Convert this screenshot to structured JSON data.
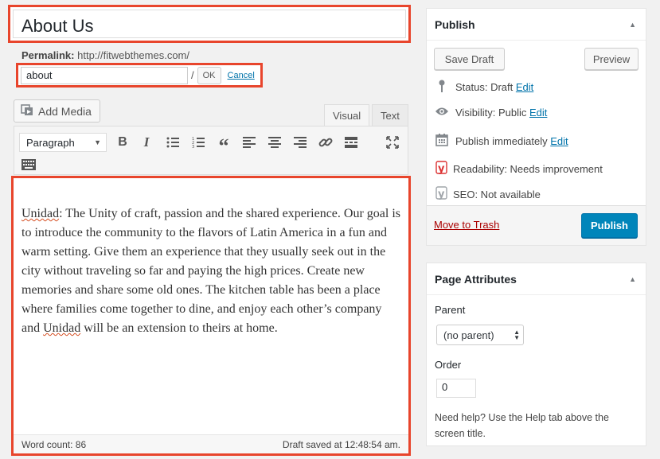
{
  "title": {
    "value": "About Us"
  },
  "permalink": {
    "label": "Permalink:",
    "base_url": "http://fitwebthemes.com/",
    "slug": "about",
    "slash": "/",
    "ok_label": "OK",
    "cancel_label": "Cancel"
  },
  "media": {
    "add_media_label": "Add Media"
  },
  "editor_tabs": {
    "visual": "Visual",
    "text": "Text"
  },
  "toolbar": {
    "format_value": "Paragraph",
    "icons": [
      "bold-icon",
      "italic-icon",
      "bullet-list-icon",
      "numbered-list-icon",
      "blockquote-icon",
      "align-left-icon",
      "align-center-icon",
      "align-right-icon",
      "link-icon",
      "read-more-icon",
      "fullscreen-icon",
      "toolbar-toggle-icon"
    ]
  },
  "editor": {
    "word_unidad": "Unidad",
    "text_1": ": The Unity of craft, passion and the shared experience. Our goal is to introduce the community to the flavors of Latin America in a fun and warm setting. Give them an experience that they usually seek out in the city without traveling so far and paying the high prices. Create new memories and share some old ones. The kitchen table has been a place where families come together to dine, and enjoy each other’s company and ",
    "word_unidad_2": "Unidad",
    "text_2": " will be an extension to theirs at home.",
    "word_count": "Word count: 86",
    "draft_saved": "Draft saved at 12:48:54 am."
  },
  "publish": {
    "heading": "Publish",
    "save_draft": "Save Draft",
    "preview": "Preview",
    "status_label": "Status: Draft",
    "visibility_label": "Visibility: Public",
    "schedule_label": "Publish immediately",
    "edit": "Edit",
    "readability": "Readability: Needs improvement",
    "seo": "SEO: Not available",
    "trash": "Move to Trash",
    "publish_button": "Publish",
    "accent_color": "#0085ba"
  },
  "page_attributes": {
    "heading": "Page Attributes",
    "parent_label": "Parent",
    "parent_value": "(no parent)",
    "order_label": "Order",
    "order_value": "0",
    "help": "Need help? Use the Help tab above the screen title."
  }
}
